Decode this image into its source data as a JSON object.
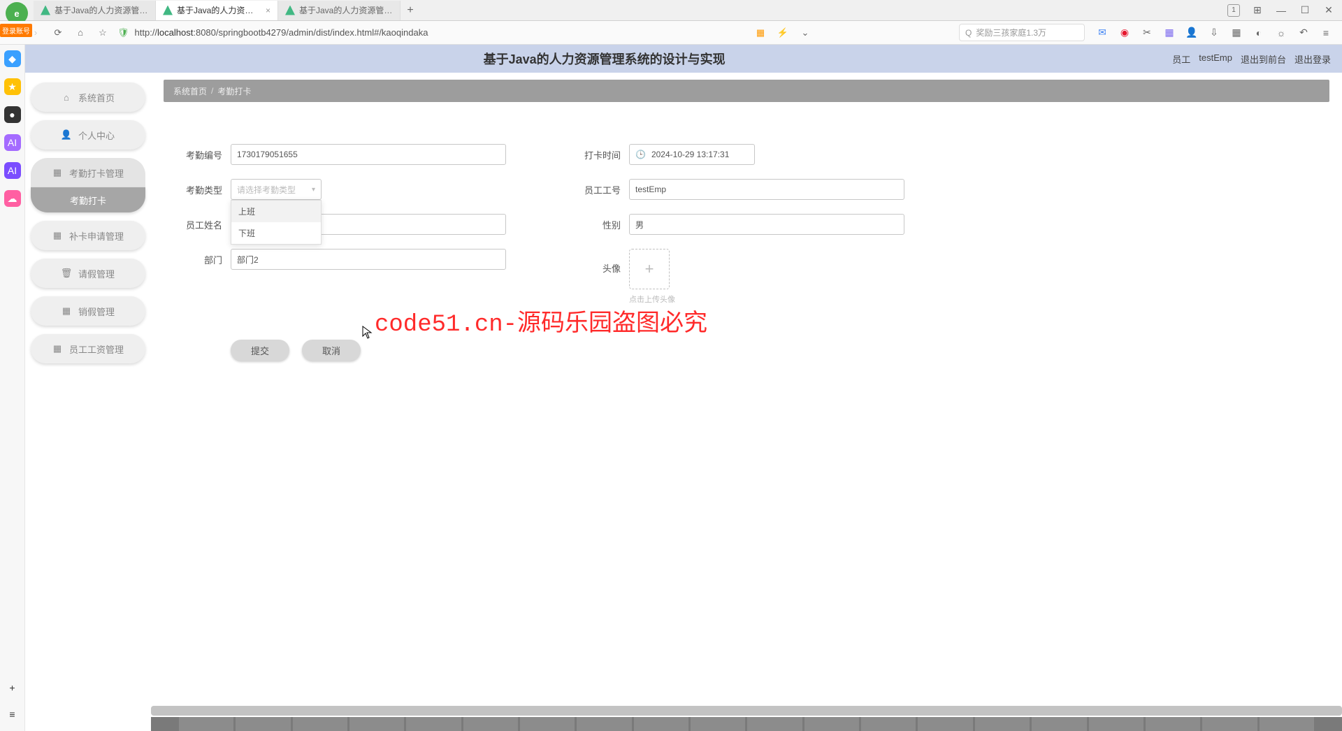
{
  "browser": {
    "tabs": [
      {
        "title": "基于Java的人力资源管理系统的"
      },
      {
        "title": "基于Java的人力资源管理系统的"
      },
      {
        "title": "基于Java的人力资源管理系统的"
      }
    ],
    "login_badge": "登录账号",
    "url_prefix": "http://",
    "url_host": "localhost",
    "url_rest": ":8080/springbootb4279/admin/dist/index.html#/kaoqindaka",
    "search_placeholder": "奖励三孩家庭1.3万",
    "reader_badge": "1"
  },
  "header": {
    "title": "基于Java的人力资源管理系统的设计与实现",
    "user_role": "员工",
    "user_name": "testEmp",
    "link_front": "退出到前台",
    "link_logout": "退出登录"
  },
  "nav": {
    "items": [
      {
        "label": "系统首页",
        "icon": "home"
      },
      {
        "label": "个人中心",
        "icon": "user"
      },
      {
        "label": "考勤打卡管理",
        "icon": "grid"
      },
      {
        "label": "考勤打卡",
        "sub": true
      },
      {
        "label": "补卡申请管理",
        "icon": "grid"
      },
      {
        "label": "请假管理",
        "icon": "trash"
      },
      {
        "label": "销假管理",
        "icon": "grid"
      },
      {
        "label": "员工工资管理",
        "icon": "grid"
      }
    ]
  },
  "breadcrumb": {
    "root": "系统首页",
    "current": "考勤打卡"
  },
  "form": {
    "number_label": "考勤编号",
    "number_value": "1730179051655",
    "type_label": "考勤类型",
    "type_placeholder": "请选择考勤类型",
    "type_options": [
      "上班",
      "下班"
    ],
    "name_label": "员工姓名",
    "name_value": "",
    "dept_label": "部门",
    "dept_value": "部门2",
    "time_label": "打卡时间",
    "time_value": "2024-10-29 13:17:31",
    "empid_label": "员工工号",
    "empid_value": "testEmp",
    "gender_label": "性别",
    "gender_value": "男",
    "avatar_label": "头像",
    "avatar_hint": "点击上传头像",
    "submit": "提交",
    "cancel": "取消"
  },
  "watermark": "code51.cn-源码乐园盗图必究"
}
